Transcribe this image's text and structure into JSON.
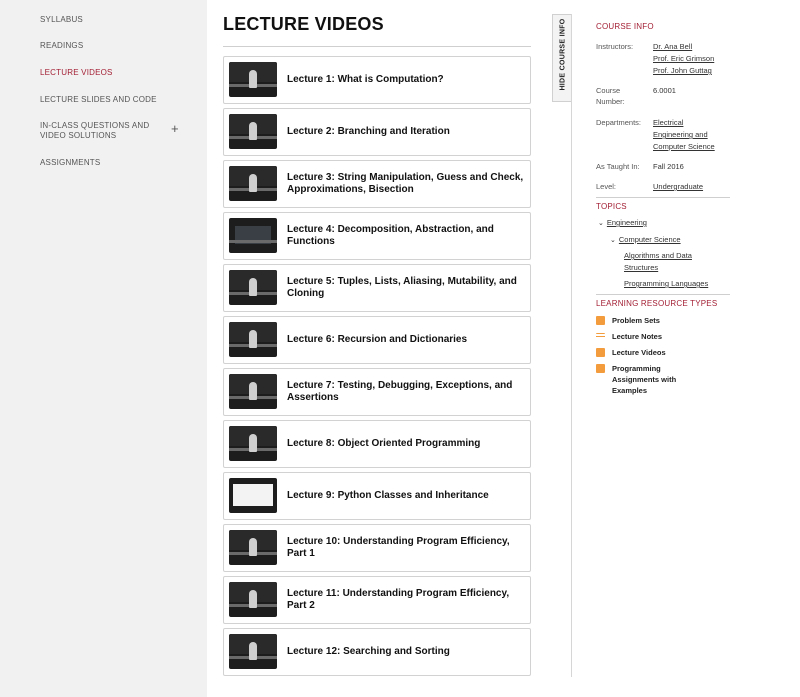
{
  "sidebar": {
    "items": [
      {
        "label": "SYLLABUS"
      },
      {
        "label": "READINGS"
      },
      {
        "label": "LECTURE VIDEOS"
      },
      {
        "label": "LECTURE SLIDES AND CODE"
      },
      {
        "label": "IN-CLASS QUESTIONS AND VIDEO SOLUTIONS"
      },
      {
        "label": "ASSIGNMENTS"
      }
    ],
    "expand_symbol": "+"
  },
  "main": {
    "title": "LECTURE VIDEOS",
    "lectures": [
      {
        "title": "Lecture 1: What is Computation?"
      },
      {
        "title": "Lecture 2: Branching and Iteration"
      },
      {
        "title": "Lecture 3: String Manipulation, Guess and Check, Approximations, Bisection"
      },
      {
        "title": "Lecture 4: Decomposition, Abstraction, and Functions"
      },
      {
        "title": "Lecture 5: Tuples, Lists, Aliasing, Mutability, and Cloning"
      },
      {
        "title": "Lecture 6: Recursion and Dictionaries"
      },
      {
        "title": "Lecture 7: Testing, Debugging, Exceptions, and Assertions"
      },
      {
        "title": "Lecture 8: Object Oriented Programming"
      },
      {
        "title": "Lecture 9: Python Classes and Inheritance"
      },
      {
        "title": "Lecture 10: Understanding Program Efficiency, Part 1"
      },
      {
        "title": "Lecture 11: Understanding Program Efficiency, Part 2"
      },
      {
        "title": "Lecture 12: Searching and Sorting"
      }
    ]
  },
  "hide_tab": {
    "label": "HIDE COURSE INFO"
  },
  "course_info": {
    "heading": "COURSE INFO",
    "instructors_label": "Instructors:",
    "instructors": [
      "Dr. Ana Bell",
      "Prof. Eric Grimson",
      "Prof. John Guttag"
    ],
    "course_number_label": "Course Number:",
    "course_number_label_line1": "Course",
    "course_number_label_line2": "Number:",
    "course_number": "6.0001",
    "departments_label": "Departments:",
    "departments": "Electrical Engineering and Computer Science",
    "departments_lines": [
      "Electrical",
      "Engineering and",
      "Computer Science"
    ],
    "taught_label": "As Taught In:",
    "taught": "Fall 2016",
    "level_label": "Level:",
    "level": "Undergraduate"
  },
  "topics": {
    "heading": "TOPICS",
    "engineering": "Engineering",
    "computer_science": "Computer Science",
    "algorithms_lines": [
      "Algorithms and Data",
      "Structures"
    ],
    "programming_languages": "Programming Languages",
    "chevron": "⌄"
  },
  "learning_resources": {
    "heading": "LEARNING RESOURCE TYPES",
    "items": [
      {
        "label": "Problem Sets"
      },
      {
        "label": "Lecture Notes"
      },
      {
        "label": "Lecture Videos"
      },
      {
        "label_lines": [
          "Programming",
          "Assignments with",
          "Examples"
        ]
      }
    ],
    "accent_color": "#f39c3d"
  }
}
